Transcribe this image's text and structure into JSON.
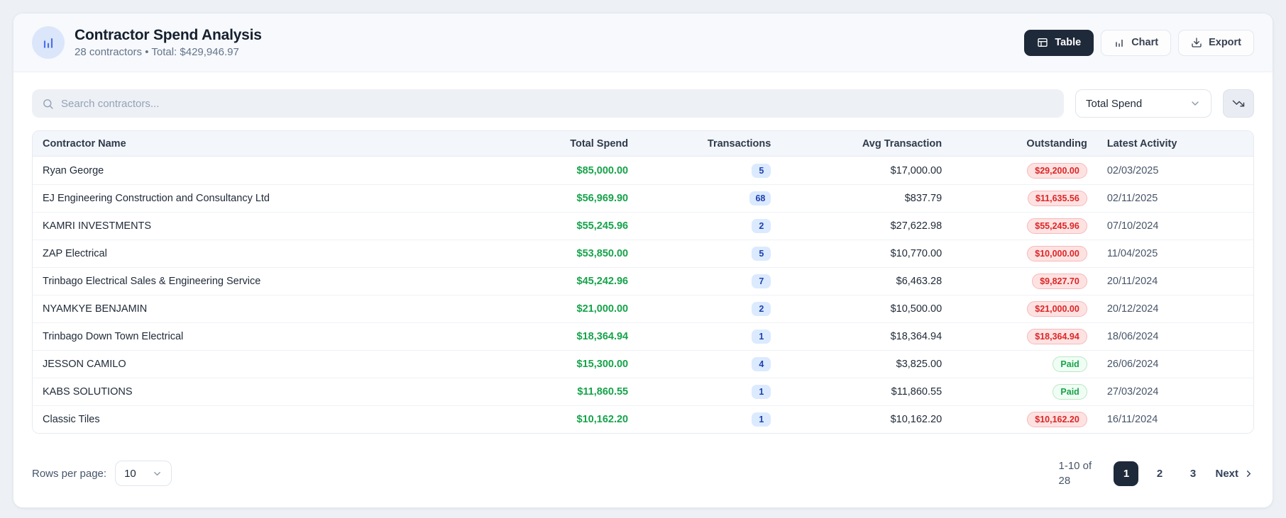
{
  "header": {
    "title": "Contractor Spend Analysis",
    "subtitle": "28 contractors • Total: $429,946.97",
    "buttons": {
      "table": "Table",
      "chart": "Chart",
      "export": "Export"
    }
  },
  "toolbar": {
    "search_placeholder": "Search contractors...",
    "sort_by": "Total Spend"
  },
  "table": {
    "columns": [
      "Contractor Name",
      "Total Spend",
      "Transactions",
      "Avg Transaction",
      "Outstanding",
      "Latest Activity"
    ],
    "rows": [
      {
        "name": "Ryan George",
        "total_spend": "$85,000.00",
        "transactions": "5",
        "avg_transaction": "$17,000.00",
        "outstanding": "$29,200.00",
        "outstanding_status": "overdue",
        "latest_activity": "02/03/2025"
      },
      {
        "name": "EJ Engineering Construction and Consultancy Ltd",
        "total_spend": "$56,969.90",
        "transactions": "68",
        "avg_transaction": "$837.79",
        "outstanding": "$11,635.56",
        "outstanding_status": "overdue",
        "latest_activity": "02/11/2025"
      },
      {
        "name": "KAMRI INVESTMENTS",
        "total_spend": "$55,245.96",
        "transactions": "2",
        "avg_transaction": "$27,622.98",
        "outstanding": "$55,245.96",
        "outstanding_status": "overdue",
        "latest_activity": "07/10/2024"
      },
      {
        "name": "ZAP Electrical",
        "total_spend": "$53,850.00",
        "transactions": "5",
        "avg_transaction": "$10,770.00",
        "outstanding": "$10,000.00",
        "outstanding_status": "overdue",
        "latest_activity": "11/04/2025"
      },
      {
        "name": "Trinbago Electrical Sales & Engineering Service",
        "total_spend": "$45,242.96",
        "transactions": "7",
        "avg_transaction": "$6,463.28",
        "outstanding": "$9,827.70",
        "outstanding_status": "overdue",
        "latest_activity": "20/11/2024"
      },
      {
        "name": "NYAMKYE BENJAMIN",
        "total_spend": "$21,000.00",
        "transactions": "2",
        "avg_transaction": "$10,500.00",
        "outstanding": "$21,000.00",
        "outstanding_status": "overdue",
        "latest_activity": "20/12/2024"
      },
      {
        "name": "Trinbago Down Town Electrical",
        "total_spend": "$18,364.94",
        "transactions": "1",
        "avg_transaction": "$18,364.94",
        "outstanding": "$18,364.94",
        "outstanding_status": "overdue",
        "latest_activity": "18/06/2024"
      },
      {
        "name": "JESSON CAMILO",
        "total_spend": "$15,300.00",
        "transactions": "4",
        "avg_transaction": "$3,825.00",
        "outstanding": "Paid",
        "outstanding_status": "paid",
        "latest_activity": "26/06/2024"
      },
      {
        "name": "KABS SOLUTIONS",
        "total_spend": "$11,860.55",
        "transactions": "1",
        "avg_transaction": "$11,860.55",
        "outstanding": "Paid",
        "outstanding_status": "paid",
        "latest_activity": "27/03/2024"
      },
      {
        "name": "Classic Tiles",
        "total_spend": "$10,162.20",
        "transactions": "1",
        "avg_transaction": "$10,162.20",
        "outstanding": "$10,162.20",
        "outstanding_status": "overdue",
        "latest_activity": "16/11/2024"
      }
    ]
  },
  "footer": {
    "rows_per_page_label": "Rows per page:",
    "rows_per_page_value": "10",
    "range_text": "1-10 of 28",
    "pages": [
      "1",
      "2",
      "3"
    ],
    "active_page": "1",
    "next_label": "Next"
  },
  "colors": {
    "accent_dark": "#1e2939",
    "icon_blue": "#4c6fe7",
    "icon_circle_bg": "#dbe6fa",
    "money_green": "#16a34a",
    "tx_badge_bg": "#dbeafe",
    "tx_badge_text": "#1e40af",
    "overdue_badge_bg": "#fee2e2",
    "overdue_badge_text": "#dc2626",
    "paid_badge_bg": "#f0fdf4",
    "paid_badge_text": "#16a34a",
    "page_bg": "#edf0f5",
    "header_band_bg": "#f7f9fc"
  }
}
